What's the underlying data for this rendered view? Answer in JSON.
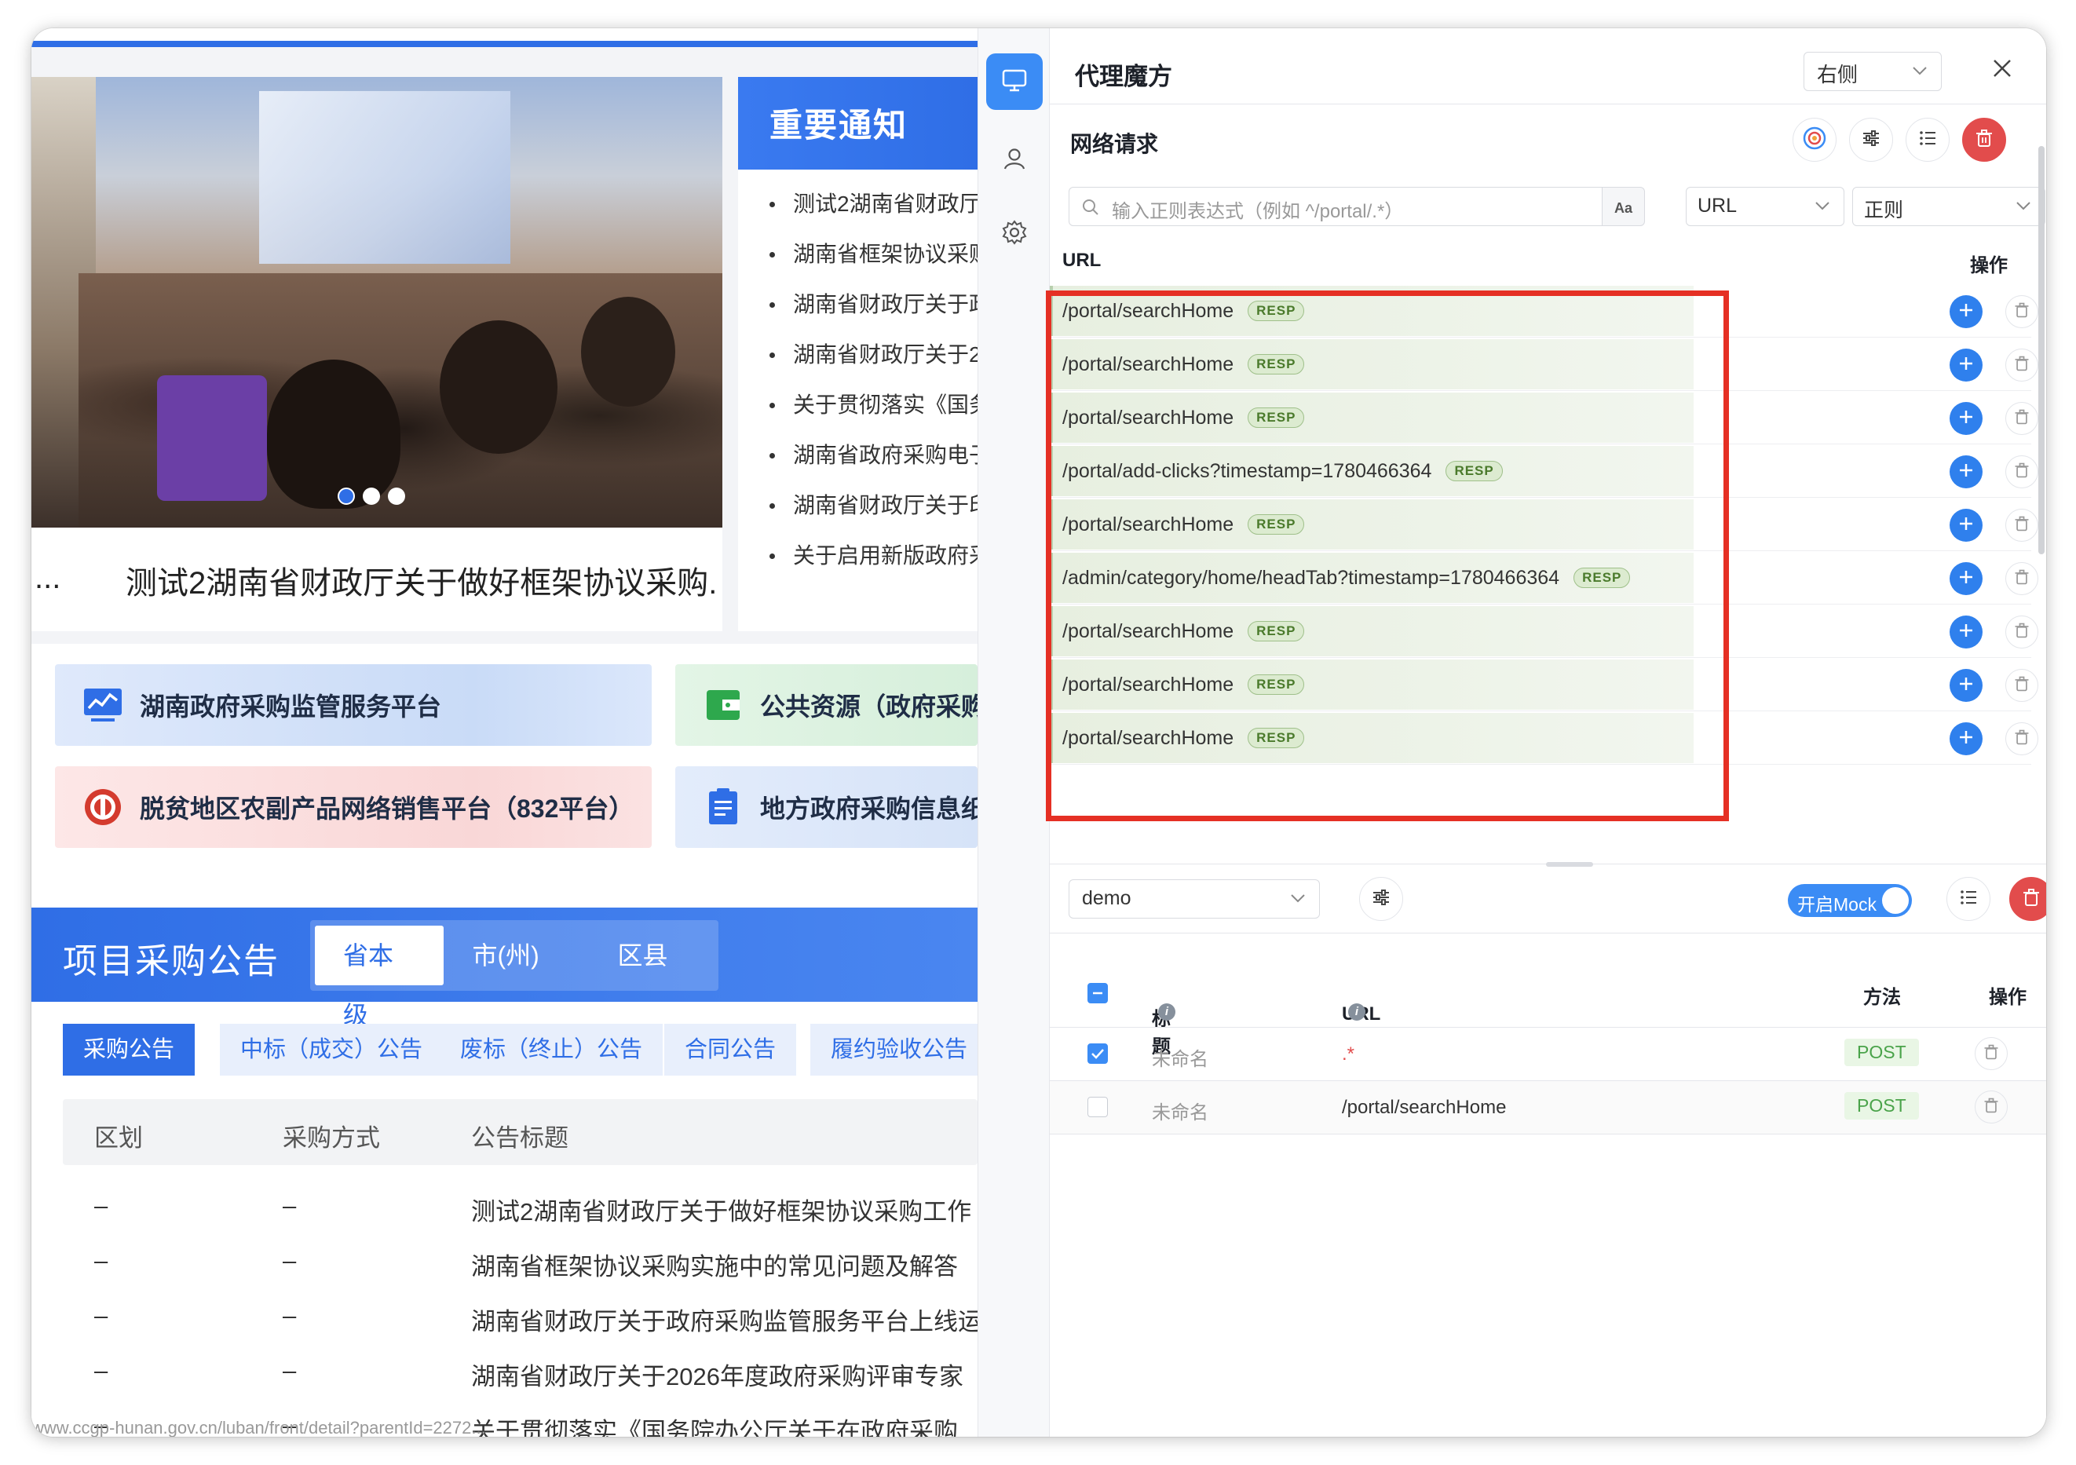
{
  "website": {
    "carousel": {
      "caption": "测试2湖南省财政厅关于做好框架协议采购.",
      "ellipsis": "...",
      "slides": 3,
      "active_slide": 1
    },
    "notice": {
      "title": "重要通知",
      "items": [
        "测试2湖南省财政厅",
        "湖南省框架协议采购",
        "湖南省财政厅关于政",
        "湖南省财政厅关于2",
        "关于贯彻落实《国务",
        "湖南省政府采购电子",
        "湖南省财政厅关于印",
        "关于启用新版政府采"
      ]
    },
    "platforms": [
      {
        "label": "湖南政府采购监管服务平台",
        "icon": "chart-line-icon"
      },
      {
        "label": "公共资源（政府采购",
        "icon": "wallet-icon"
      },
      {
        "label": "脱贫地区农副产品网络销售平台（832平台）",
        "icon": "emblem-icon"
      },
      {
        "label": "地方政府采购信息纸",
        "icon": "document-icon"
      }
    ],
    "project": {
      "title": "项目采购公告",
      "levels": [
        "省本级",
        "市(州)级",
        "区县级"
      ],
      "categories": [
        "采购公告",
        "中标（成交）公告",
        "废标（终止）公告",
        "合同公告",
        "履约验收公告"
      ],
      "columns": [
        "区划",
        "采购方式",
        "公告标题"
      ],
      "rows": [
        {
          "region": "–",
          "method": "–",
          "title": "测试2湖南省财政厅关于做好框架协议采购工作"
        },
        {
          "region": "–",
          "method": "–",
          "title": "湖南省框架协议采购实施中的常见问题及解答"
        },
        {
          "region": "–",
          "method": "–",
          "title": "湖南省财政厅关于政府采购监管服务平台上线运"
        },
        {
          "region": "–",
          "method": "–",
          "title": "湖南省财政厅关于2026年度政府采购评审专家"
        },
        {
          "region": "–",
          "method": "–",
          "title": "关于贯彻落实《国务院办公厅关于在政府采购"
        }
      ]
    },
    "status_url": "www.ccgp-hunan.gov.cn/luban/front/detail?parentId=2272..."
  },
  "panel": {
    "title": "代理魔方",
    "dock_position": "右侧",
    "network": {
      "title": "网络请求",
      "search_placeholder": "输入正则表达式（例如 ^/portal/.*）",
      "case_button": "Aa",
      "field_select": "URL",
      "mode_select": "正则",
      "url_header": "URL",
      "op_header": "操作",
      "badge": "RESP",
      "requests": [
        "/portal/searchHome",
        "/portal/searchHome",
        "/portal/searchHome",
        "/portal/add-clicks?timestamp=1780466364",
        "/portal/searchHome",
        "/admin/category/home/headTab?timestamp=1780466364",
        "/portal/searchHome",
        "/portal/searchHome",
        "/portal/searchHome"
      ]
    },
    "mock": {
      "group_select": "demo",
      "toggle_label": "开启Mock",
      "toggle_on": true,
      "columns": {
        "title": "标题",
        "url": "URL",
        "method": "方法",
        "op": "操作"
      },
      "rules": [
        {
          "title": "未命名",
          "url": ".*",
          "method": "POST",
          "checked": true
        },
        {
          "title": "未命名",
          "url": "/portal/searchHome",
          "method": "POST",
          "checked": false
        }
      ]
    }
  },
  "colors": {
    "brand_blue": "#2f6ee6",
    "accent": "#3b8cf5",
    "danger": "#e24c4c",
    "highlight_box": "#e53024",
    "resp_green": "#4a7a2b"
  }
}
